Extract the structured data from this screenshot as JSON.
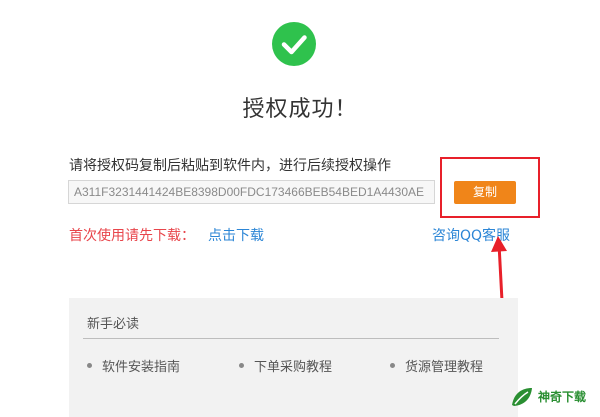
{
  "header": {
    "success_title": "授权成功！",
    "status_icon": "check-circle-icon",
    "status_color": "#2fc24d"
  },
  "license": {
    "instruction": "请将授权码复制后粘贴到软件内，进行后续授权操作",
    "code": "A311F3231441424BE8398D00FDC173466BEB54BED1A4430AE",
    "copy_label": "复制",
    "button_color": "#f08519",
    "highlight_color": "#e8202a"
  },
  "download": {
    "prompt": "首次使用请先下载：",
    "link_label": "点击下载"
  },
  "support": {
    "link_label": "咨询QQ客服"
  },
  "guide": {
    "title": "新手必读",
    "items": [
      {
        "label": "软件安装指南"
      },
      {
        "label": "下单采购教程"
      },
      {
        "label": "货源管理教程"
      }
    ]
  },
  "watermark": {
    "text": "神奇下载",
    "icon": "leaf-logo-icon"
  }
}
